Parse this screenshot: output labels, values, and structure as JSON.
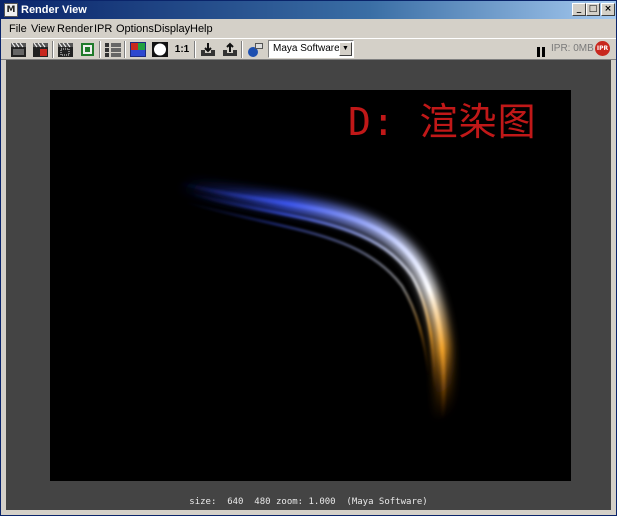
{
  "window": {
    "title": "Render View"
  },
  "title_buttons": {
    "minimize": "_",
    "maximize": "□",
    "close": "×"
  },
  "menubar": {
    "items": [
      "File",
      "View",
      "Render",
      "IPR",
      "Options",
      "Display",
      "Help"
    ]
  },
  "toolbar": {
    "one_to_one_label": "1:1",
    "renderer": {
      "selected": "Maya Software"
    },
    "ipr_memory": "IPR: 0MB",
    "ipr_icon_label": "IPR"
  },
  "canvas": {
    "overlay_label": "D: 渲染图",
    "colors": {
      "label": "#c01818",
      "background": "#000000"
    }
  },
  "status": {
    "text": "size:  640  480 zoom: 1.000  (Maya Software)"
  },
  "icons": [
    "render-frame-icon",
    "redo-render-icon",
    "render-region-icon",
    "snapshot-icon",
    "render-settings-icon",
    "rgb-channels-icon",
    "alpha-channel-icon",
    "keep-image-icon",
    "remove-image-icon",
    "ipr-render-icon",
    "pause-icon",
    "ipr-icon"
  ]
}
